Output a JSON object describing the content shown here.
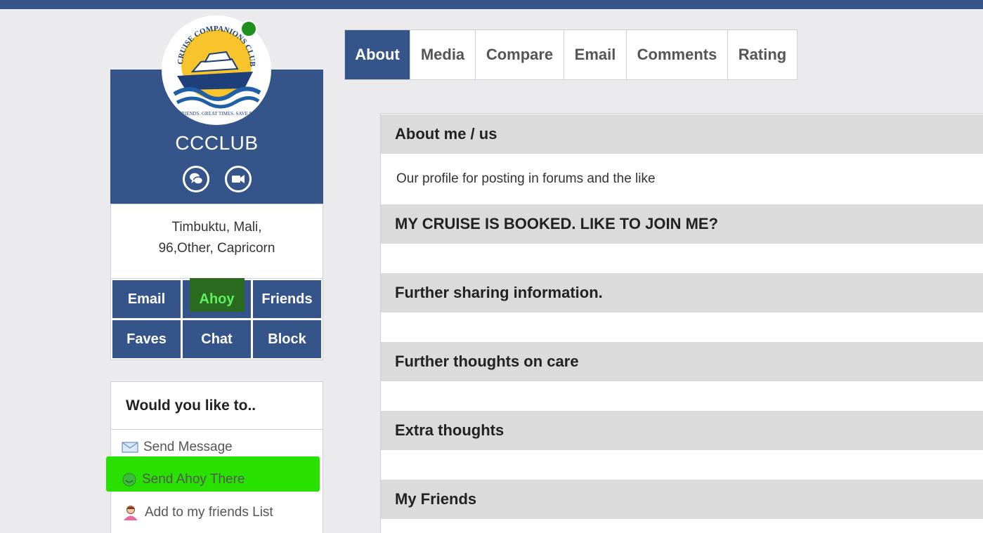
{
  "profile": {
    "username": "CCCLUB",
    "logo_text": "CRUISE COMPANIONS CLUB",
    "logo_tagline": "FRIENDS. GREAT TIMES. SAVE $$",
    "location_line1": "Timbuktu, Mali,",
    "location_line2": "96,Other, Capricorn",
    "online": true
  },
  "actions": [
    "Email",
    "Ahoy",
    "Friends",
    "Faves",
    "Chat",
    "Block"
  ],
  "would": {
    "title": "Would you like to..",
    "items": [
      "Send Message",
      "Send Ahoy There",
      "Add to my friends List"
    ]
  },
  "tabs": [
    "About",
    "Media",
    "Compare",
    "Email",
    "Comments",
    "Rating"
  ],
  "sections": [
    {
      "title": "About me / us",
      "body": "Our profile for posting in forums and the like"
    },
    {
      "title": "MY CRUISE IS BOOKED. LIKE TO JOIN ME?",
      "body": ""
    },
    {
      "title": "Further sharing information.",
      "body": ""
    },
    {
      "title": "Further thoughts on care",
      "body": ""
    },
    {
      "title": "Extra thoughts",
      "body": ""
    },
    {
      "title": "My Friends",
      "body": ""
    }
  ],
  "colors": {
    "primary": "#34548a",
    "highlight": "#28e100",
    "online": "#1f8f1f"
  }
}
